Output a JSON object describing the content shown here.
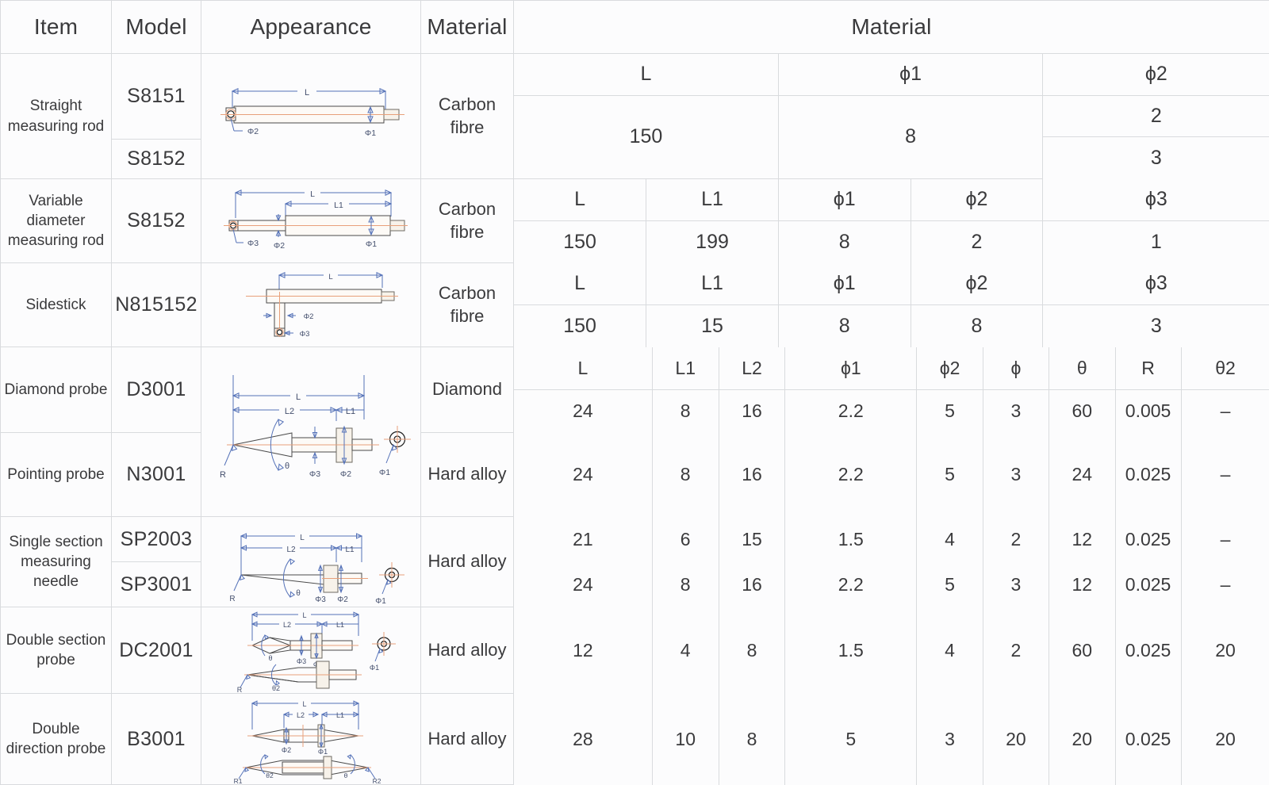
{
  "header": {
    "item": "Item",
    "model": "Model",
    "appearance": "Appearance",
    "material": "Material",
    "spec": "Material"
  },
  "rows": [
    {
      "item": "Straight measuring rod",
      "models": [
        "S8151",
        "S8152"
      ],
      "material": "Carbon fibre",
      "drawing": "straight-measuring-rod-diagram",
      "dim_headers": [
        "L",
        "ϕ1",
        "ϕ2"
      ],
      "dim_values": [
        "150",
        "8"
      ],
      "phi2_values": [
        "2",
        "3"
      ]
    },
    {
      "item": "Variable diameter measuring rod",
      "models": [
        "S8152"
      ],
      "material": "Carbon fibre",
      "drawing": "variable-diameter-rod-diagram",
      "dim_headers": [
        "L",
        "L1",
        "ϕ1",
        "ϕ2",
        "ϕ3"
      ],
      "dim_values": [
        "150",
        "199",
        "8",
        "2",
        "1"
      ]
    },
    {
      "item": "Sidestick",
      "models": [
        "N815152"
      ],
      "material": "Carbon fibre",
      "drawing": "sidestick-diagram",
      "dim_headers": [
        "L",
        "L1",
        "ϕ1",
        "ϕ2",
        "ϕ3"
      ],
      "dim_values": [
        "150",
        "15",
        "8",
        "8",
        "3"
      ]
    },
    {
      "item": "Diamond probe",
      "models": [
        "D3001"
      ],
      "material": "Diamond",
      "drawing": "pointing-probe-diagram",
      "dim_headers": [
        "L",
        "L1",
        "L2",
        "ϕ1",
        "ϕ2",
        "ϕ",
        "θ",
        "R",
        "θ2"
      ],
      "dim_values": [
        "24",
        "8",
        "16",
        "2.2",
        "5",
        "3",
        "60",
        "0.005",
        "–"
      ]
    },
    {
      "item": "Pointing probe",
      "models": [
        "N3001"
      ],
      "material": "Hard alloy",
      "dim_values": [
        "24",
        "8",
        "16",
        "2.2",
        "5",
        "3",
        "24",
        "0.025",
        "–"
      ]
    },
    {
      "item": "Single section measuring needle",
      "models": [
        "SP2003",
        "SP3001"
      ],
      "material": "Hard alloy",
      "drawing": "single-section-needle-diagram",
      "dim_values_a": [
        "21",
        "6",
        "15",
        "1.5",
        "4",
        "2",
        "12",
        "0.025",
        "–"
      ],
      "dim_values_b": [
        "24",
        "8",
        "16",
        "2.2",
        "5",
        "3",
        "12",
        "0.025",
        "–"
      ]
    },
    {
      "item": "Double section probe",
      "models": [
        "DC2001"
      ],
      "material": "Hard alloy",
      "drawing": "double-section-probe-diagram",
      "dim_values": [
        "12",
        "4",
        "8",
        "1.5",
        "4",
        "2",
        "60",
        "0.025",
        "20"
      ]
    },
    {
      "item": "Double direction probe",
      "models": [
        "B3001"
      ],
      "material": "Hard alloy",
      "drawing": "double-direction-probe-diagram",
      "dim_values": [
        "28",
        "10",
        "8",
        "5",
        "3",
        "20",
        "20",
        "0.025",
        "20"
      ]
    }
  ],
  "drawing_labels": {
    "L": "L",
    "L1": "L1",
    "L2": "L2",
    "phi1": "Φ1",
    "phi2": "Φ2",
    "phi3": "Φ3",
    "theta": "θ",
    "R": "R",
    "R1": "R1",
    "R2": "R2"
  },
  "colors": {
    "border": "#d9dbde",
    "background": "#fcfcfd",
    "text": "#3a3a3c",
    "dimension_line": "#5572b8",
    "center_axis": "#e8a07a"
  }
}
